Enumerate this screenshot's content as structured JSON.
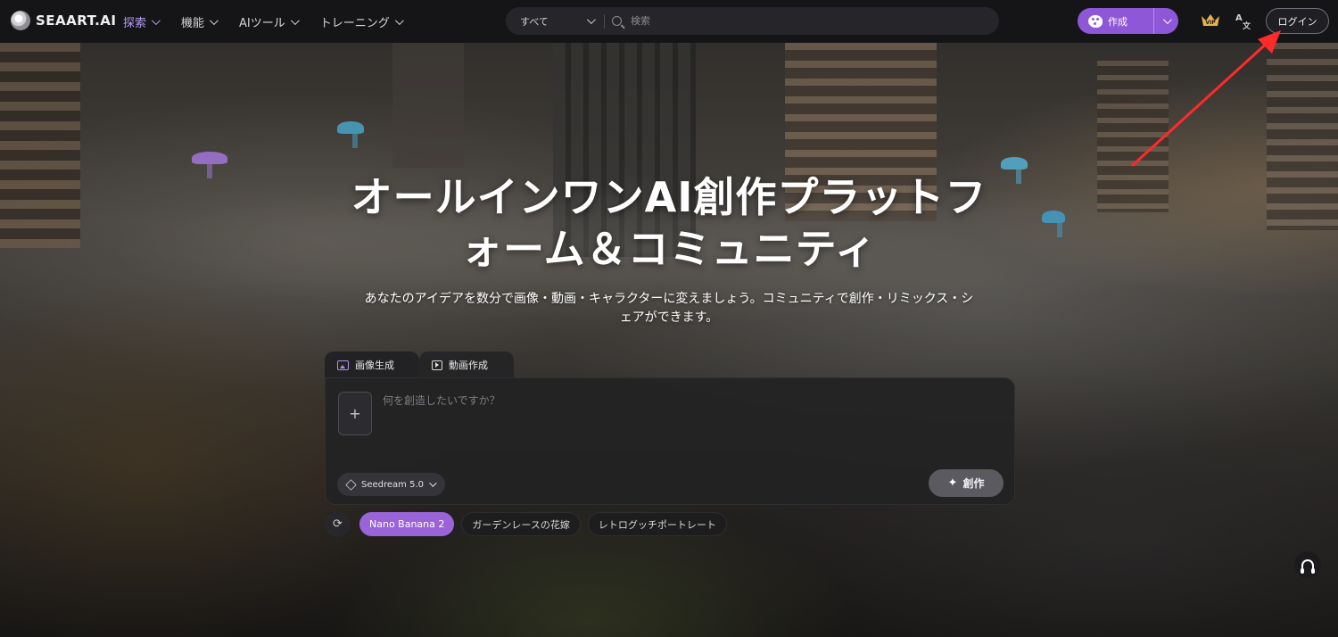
{
  "brand": {
    "name": "SEAART.AI"
  },
  "nav": {
    "items": [
      {
        "label": "探索",
        "active": true
      },
      {
        "label": "機能",
        "active": false
      },
      {
        "label": "AIツール",
        "active": false
      },
      {
        "label": "トレーニング",
        "active": false
      }
    ]
  },
  "search": {
    "scope": "すべて",
    "placeholder": "検索"
  },
  "header": {
    "create_label": "作成",
    "vip_icon": "vip-crown-icon",
    "lang_icon": "translate-icon",
    "login_label": "ログイン"
  },
  "hero": {
    "title_line1": "オールインワンAI創作プラットフ",
    "title_line2": "ォーム＆コミュニティ",
    "subtitle_line1": "あなたのアイデアを数分で画像・動画・キャラクターに変えましょう。コミュニティで創作・リミックス・シ",
    "subtitle_line2": "ェアができます。"
  },
  "composer": {
    "tabs": [
      {
        "label": "画像生成",
        "active": true
      },
      {
        "label": "動画作成",
        "active": false
      }
    ],
    "upload_label": "+",
    "prompt_placeholder": "何を創造したいですか？",
    "model": "Seedream 5.0",
    "submit_label": "創作"
  },
  "suggestions": {
    "chips": [
      {
        "label": "Nano Banana 2",
        "active": true
      },
      {
        "label": "ガーデンレースの花嫁",
        "active": false
      },
      {
        "label": "レトログッチポートレート",
        "active": false
      }
    ]
  },
  "colors": {
    "accent": "#8e57d8",
    "chip_active": "#9a63d8",
    "nav_active": "#b69cf3",
    "annotation_arrow": "#ff2a2a"
  }
}
